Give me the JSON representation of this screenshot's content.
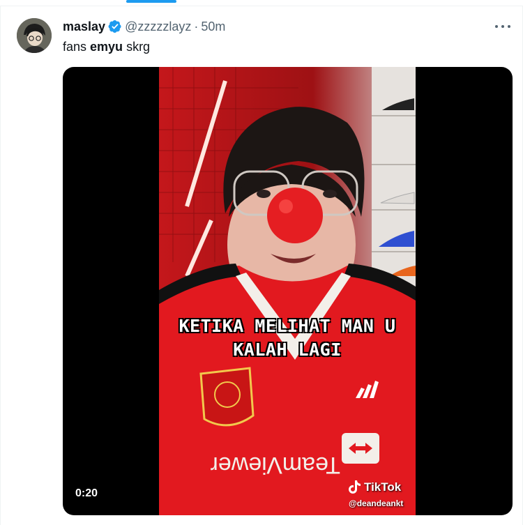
{
  "tweet": {
    "name": "maslay",
    "handle": "@zzzzzlayz",
    "separator": "·",
    "time": "50m",
    "text_before": "fans ",
    "text_bold": "emyu",
    "text_after": " skrg"
  },
  "video": {
    "caption_line1": "KETIKA MELIHAT MAN U",
    "caption_line2": "KALAH LAGI",
    "duration": "0:20",
    "watermark": "TikTok",
    "watermark_user": "@deandeankt",
    "jersey_sponsor": "TeamViewer"
  },
  "icons": {
    "verified": "verified-badge-icon",
    "more": "more-options-icon"
  },
  "colors": {
    "accent": "#1d9bf0",
    "text": "#0f1419",
    "muted": "#536471"
  }
}
